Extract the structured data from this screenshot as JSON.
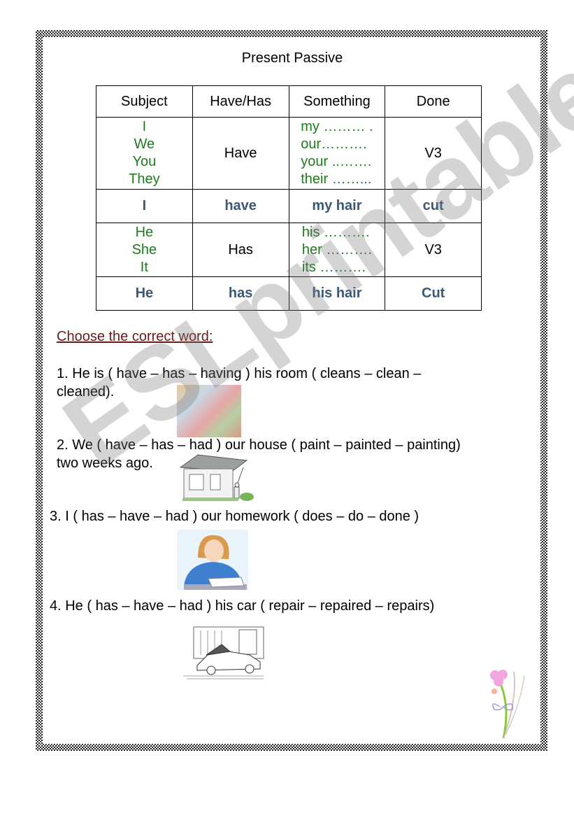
{
  "title": "Present Passive",
  "table": {
    "headers": [
      "Subject",
      "Have/Has",
      "Something",
      "Done"
    ],
    "block1": {
      "subjects": [
        "I",
        "We",
        "You",
        "They"
      ],
      "verb": "Have",
      "possessives": [
        "my ……… .",
        "our……….",
        "your ..…….",
        "their ……..."
      ],
      "done": "V3"
    },
    "example1": [
      "I",
      "have",
      "my hair",
      "cut"
    ],
    "block2": {
      "subjects": [
        "He",
        "She",
        "It"
      ],
      "verb": "Has",
      "possessives": [
        "his ……….",
        "her ……….",
        "its ………."
      ],
      "done": "V3"
    },
    "example2": [
      "He",
      "has",
      "his hair",
      "Cut"
    ]
  },
  "watermark": "ESLprintables.com",
  "instruction": "Choose the correct word:",
  "questions": [
    {
      "line1": "1. He is ( have – has – having ) his room ( cleans – clean –",
      "line2": "cleaned).",
      "image": "boy-cleaning-room"
    },
    {
      "line1": "2. We ( have – has – had ) our house ( paint – painted – painting)",
      "line2": "two weeks ago.",
      "image": "man-painting-house"
    },
    {
      "line1": "3. I ( has – have – had ) our homework ( does – do – done )",
      "line2": "",
      "image": "girl-doing-homework"
    },
    {
      "line1": "4. He ( has – have – had ) his car ( repair – repaired – repairs)",
      "line2": "",
      "image": "car-repair-garage"
    }
  ],
  "colors": {
    "green": "#1e7a1e",
    "blue": "#3b5878",
    "instruction": "#6b1a1a"
  }
}
